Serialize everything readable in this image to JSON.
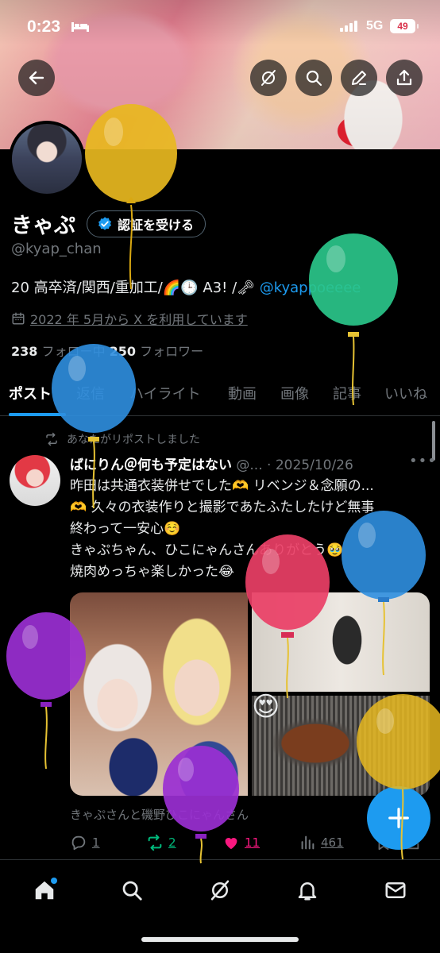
{
  "status_bar": {
    "time": "0:23",
    "network": "5G",
    "battery": "49"
  },
  "profile": {
    "name": "きゃぷ",
    "verify_label": "認証を受ける",
    "handle": "@kyap_chan",
    "bio_text": "20 高卒済/関西/重加工/🌈🕒 A3! /🗝 ",
    "bio_link": "@kyappoeeee",
    "joined": "2022 年 5月から X を利用しています",
    "following_count": "238",
    "following_label": " フォロー中 ",
    "followers_count": "250",
    "followers_label": " フォロワー"
  },
  "tabs": [
    {
      "label": "ポスト",
      "active": true
    },
    {
      "label": "返信"
    },
    {
      "label": "ハイライト"
    },
    {
      "label": "動画"
    },
    {
      "label": "画像"
    },
    {
      "label": "記事"
    },
    {
      "label": "いいね"
    }
  ],
  "post": {
    "repost_notice": "あなたがリポストしました",
    "author": "ばにりん＠何も予定はない",
    "handle_short": " @...",
    "date": " · 2025/10/26",
    "lines": [
      "昨田は共通衣装併せでした🫶 リベンジ＆念願の...",
      "🫶 久々の衣装作りと撮影であたふたしたけど無事",
      "終わって一安心☺️",
      "きゃぷちゃん、ひこにゃんさんありがとう🥹",
      "焼肉めっちゃ楽しかった😂"
    ],
    "media_emoji": "😍",
    "tagged": "きゃぷさんと磯野ひこにゃんさん",
    "replies": "1",
    "reposts": "2",
    "likes": "11",
    "views": "461"
  },
  "colors": {
    "accent": "#1d9bf0",
    "repost_green": "#00ba7c",
    "like_pink": "#f91880",
    "muted": "#71767b"
  },
  "balloons": [
    {
      "color": "yellow"
    },
    {
      "color": "green"
    },
    {
      "color": "blue"
    },
    {
      "color": "red"
    },
    {
      "color": "blue"
    },
    {
      "color": "purple"
    },
    {
      "color": "purple"
    },
    {
      "color": "yellow"
    }
  ],
  "icons": {
    "back": "back-arrow-icon",
    "grok": "grok-icon",
    "search": "search-icon",
    "edit": "edit-icon",
    "share": "share-icon",
    "calendar": "calendar-icon",
    "verified": "verified-badge-icon",
    "compose": "plus-icon",
    "nav": [
      "home-icon",
      "search-icon",
      "grok-icon",
      "bell-icon",
      "mail-icon"
    ]
  }
}
